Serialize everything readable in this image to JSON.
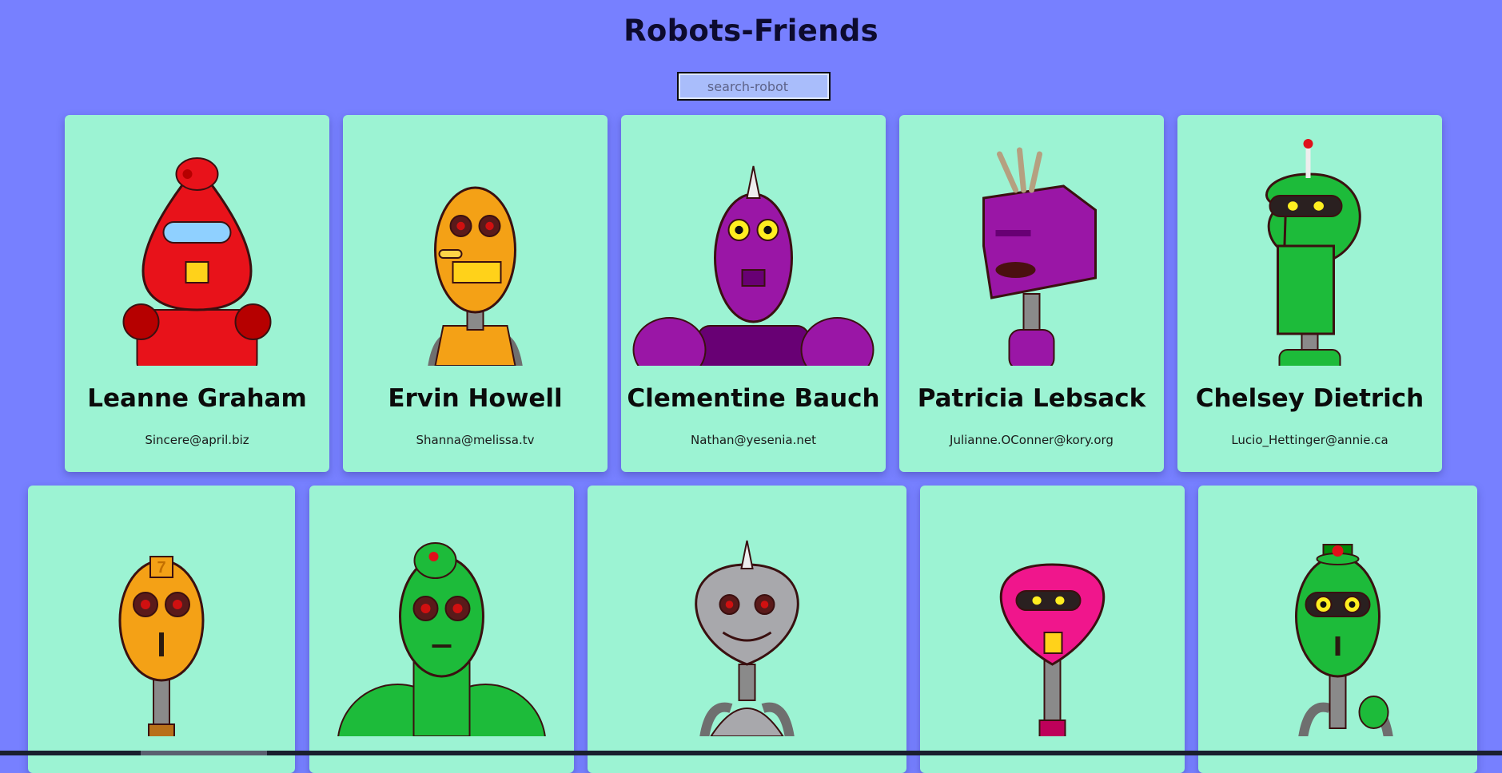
{
  "app": {
    "title": "Robots-Friends"
  },
  "search": {
    "placeholder": "search-robot",
    "value": ""
  },
  "robots": [
    {
      "name": "Leanne Graham",
      "email": "Sincere@april.biz",
      "color": "#e8121a",
      "face": "dome-visor"
    },
    {
      "name": "Ervin Howell",
      "email": "Shanna@melissa.tv",
      "color": "#f4a116",
      "face": "egg-grille"
    },
    {
      "name": "Clementine Bauch",
      "email": "Nathan@yesenia.net",
      "color": "#9a16a6",
      "face": "spike-vent"
    },
    {
      "name": "Patricia Lebsack",
      "email": "Julianne.OConner@kory.org",
      "color": "#9a16a6",
      "face": "box-hair"
    },
    {
      "name": "Chelsey Dietrich",
      "email": "Lucio_Hettinger@annie.ca",
      "color": "#1dbb3a",
      "face": "antenna-visor"
    },
    {
      "name": "",
      "email": "",
      "color": "#f4a116",
      "face": "seven-tag"
    },
    {
      "name": "",
      "email": "",
      "color": "#1dbb3a",
      "face": "dome-eyes"
    },
    {
      "name": "",
      "email": "",
      "color": "#a8a8ac",
      "face": "spike-grey"
    },
    {
      "name": "",
      "email": "",
      "color": "#f0168c",
      "face": "pink-visor"
    },
    {
      "name": "",
      "email": "",
      "color": "#1dbb3a",
      "face": "hat-eyes"
    }
  ],
  "colors": {
    "background": "#7780ff",
    "card": "#9cf3d3",
    "search_bg": "#a9bdfb"
  }
}
